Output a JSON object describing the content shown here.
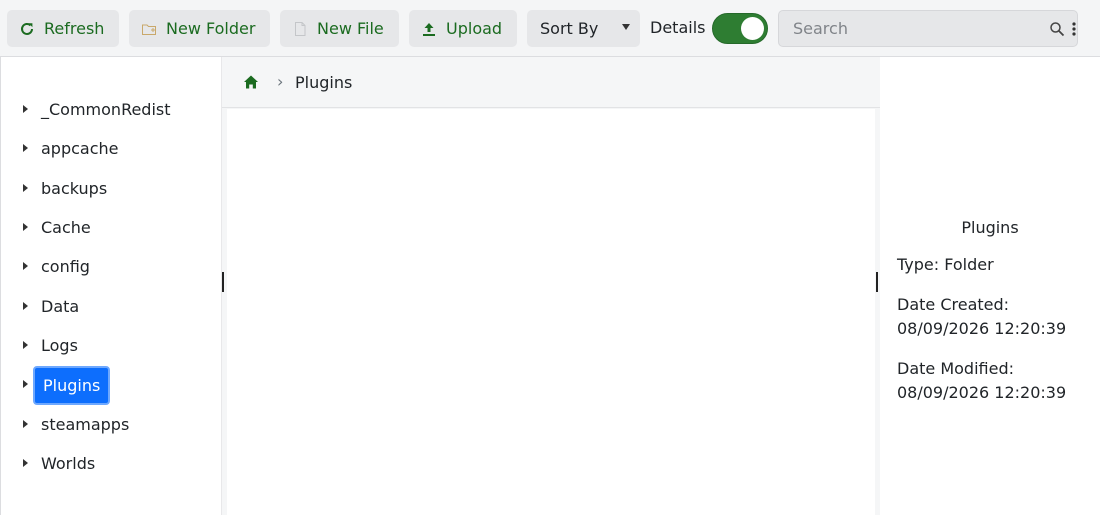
{
  "toolbar": {
    "refresh_label": "Refresh",
    "new_folder_label": "New Folder",
    "new_file_label": "New File",
    "upload_label": "Upload",
    "sort_by_label": "Sort By",
    "details_label": "Details",
    "details_toggle_on": true,
    "search_placeholder": "Search"
  },
  "sidebar": {
    "items": [
      {
        "label": "_CommonRedist"
      },
      {
        "label": "appcache"
      },
      {
        "label": "backups"
      },
      {
        "label": "Cache"
      },
      {
        "label": "config"
      },
      {
        "label": "Data"
      },
      {
        "label": "Logs"
      },
      {
        "label": "Plugins",
        "selected": true
      },
      {
        "label": "steamapps"
      },
      {
        "label": "Worlds"
      }
    ]
  },
  "breadcrumb": {
    "separator": "›",
    "current": "Plugins"
  },
  "details": {
    "title": "Plugins",
    "type": "Type: Folder",
    "created_label": "Date Created:",
    "created_value": "08/09/2026 12:20:39",
    "modified_label": "Date Modified:",
    "modified_value": "08/09/2026 12:20:39"
  },
  "colors": {
    "accent_green": "#1b6b20",
    "toggle_green": "#2e7d32",
    "selected_blue": "#0d6efd"
  }
}
